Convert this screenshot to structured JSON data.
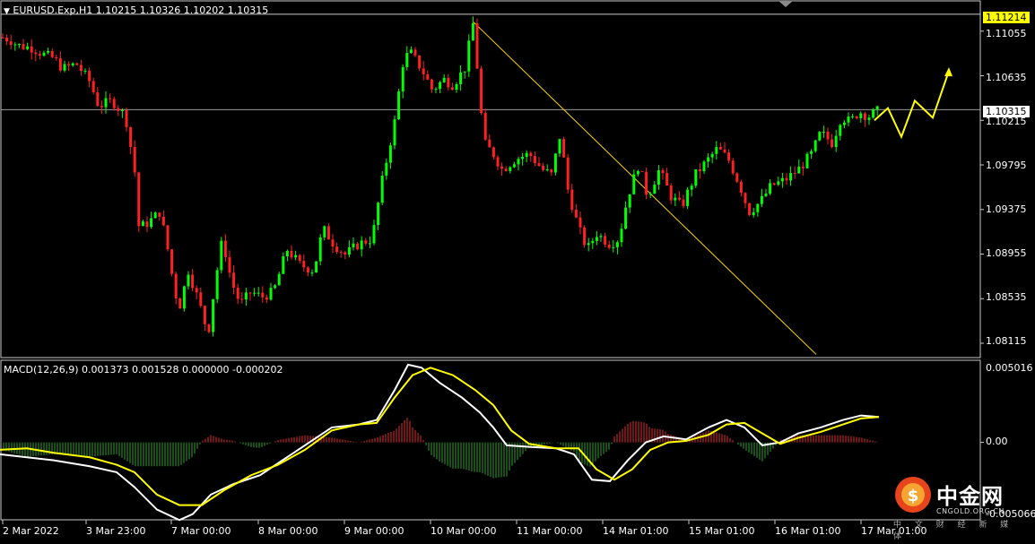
{
  "window": {
    "symbol_header": "EURUSD.Exp,H1  1.10215 1.10326 1.10202 1.10315",
    "macd_header": "MACD(12,26,9) 0.001373 0.001528 0.000000 -0.000202"
  },
  "price_axis": {
    "labels": [
      "1.11055",
      "1.10635",
      "1.10215",
      "1.09795",
      "1.09375",
      "1.08955",
      "1.08535",
      "1.08115"
    ],
    "high_badge": "1.11214",
    "current_badge": "1.10315"
  },
  "macd_axis": {
    "labels": [
      "0.005016",
      "0.00",
      "-0.005066"
    ]
  },
  "time_axis": {
    "labels": [
      "2 Mar 2022",
      "3 Mar 23:00",
      "7 Mar 00:00",
      "8 Mar 00:00",
      "9 Mar 00:00",
      "10 Mar 00:00",
      "11 Mar 00:00",
      "14 Mar 01:00",
      "15 Mar 01:00",
      "16 Mar 01:00",
      "17 Mar 01:00"
    ]
  },
  "watermark": {
    "brand": "中金网",
    "domain": "CNGOLD.ORG.CN",
    "tagline": "中 文 财 经 新 媒 体"
  },
  "colors": {
    "bull": "#00ff00",
    "bear": "#ff2020",
    "macd_line": "#ffffff",
    "signal_line": "#ffff00",
    "trendline": "#ffd800",
    "badge_high": "#ffff00",
    "badge_current": "#ffffff",
    "forecast_arrow": "#ffff00"
  },
  "chart_data": [
    {
      "type": "candlestick",
      "symbol": "EURUSD.Exp",
      "timeframe": "H1",
      "ylim": [
        1.0798,
        1.1134
      ],
      "ticks": [
        1.11055,
        1.10635,
        1.10215,
        1.09795,
        1.09375,
        1.08955,
        1.08535,
        1.08115
      ],
      "path": [
        [
          0,
          1.11
        ],
        [
          10,
          1.1098
        ],
        [
          20,
          1.1092
        ],
        [
          35,
          1.109
        ],
        [
          50,
          1.1083
        ],
        [
          60,
          1.108
        ],
        [
          70,
          1.107
        ],
        [
          85,
          1.1075
        ],
        [
          100,
          1.1058
        ],
        [
          110,
          1.1035
        ],
        [
          125,
          1.104
        ],
        [
          140,
          1.1025
        ],
        [
          150,
          1.0975
        ],
        [
          155,
          1.092
        ],
        [
          165,
          1.0925
        ],
        [
          178,
          1.0935
        ],
        [
          185,
          1.091
        ],
        [
          195,
          1.086
        ],
        [
          200,
          1.0845
        ],
        [
          210,
          1.088
        ],
        [
          222,
          1.085
        ],
        [
          232,
          1.082
        ],
        [
          240,
          1.087
        ],
        [
          248,
          1.091
        ],
        [
          258,
          1.087
        ],
        [
          268,
          1.0848
        ],
        [
          280,
          1.086
        ],
        [
          292,
          1.0855
        ],
        [
          305,
          1.086
        ],
        [
          320,
          1.09
        ],
        [
          335,
          1.0885
        ],
        [
          350,
          1.088
        ],
        [
          360,
          1.092
        ],
        [
          372,
          1.0905
        ],
        [
          385,
          1.0895
        ],
        [
          400,
          1.0905
        ],
        [
          415,
          1.091
        ],
        [
          425,
          1.096
        ],
        [
          440,
          1.102
        ],
        [
          450,
          1.108
        ],
        [
          458,
          1.1085
        ],
        [
          470,
          1.107
        ],
        [
          482,
          1.105
        ],
        [
          495,
          1.106
        ],
        [
          505,
          1.1055
        ],
        [
          518,
          1.107
        ],
        [
          528,
          1.1115
        ],
        [
          535,
          1.104
        ],
        [
          540,
          1.1
        ],
        [
          550,
          1.099
        ],
        [
          560,
          1.0975
        ],
        [
          575,
          1.0985
        ],
        [
          590,
          1.099
        ],
        [
          605,
          1.0975
        ],
        [
          615,
          1.097
        ],
        [
          625,
          1.101
        ],
        [
          632,
          1.096
        ],
        [
          645,
          1.092
        ],
        [
          655,
          1.09
        ],
        [
          665,
          1.0915
        ],
        [
          680,
          1.0905
        ],
        [
          690,
          1.091
        ],
        [
          700,
          1.095
        ],
        [
          712,
          1.098
        ],
        [
          722,
          1.095
        ],
        [
          735,
          1.0975
        ],
        [
          748,
          1.095
        ],
        [
          760,
          1.094
        ],
        [
          775,
          1.097
        ],
        [
          790,
          1.0985
        ],
        [
          800,
          1.0995
        ],
        [
          812,
          1.0985
        ],
        [
          825,
          1.096
        ],
        [
          835,
          1.0935
        ],
        [
          848,
          1.0945
        ],
        [
          860,
          1.096
        ],
        [
          875,
          1.0965
        ],
        [
          890,
          1.0975
        ],
        [
          905,
          1.099
        ],
        [
          915,
          1.101
        ],
        [
          928,
          1.1
        ],
        [
          938,
          1.1025
        ],
        [
          948,
          1.102
        ],
        [
          958,
          1.103
        ],
        [
          968,
          1.1025
        ],
        [
          978,
          1.103
        ]
      ],
      "current_price": 1.10315,
      "period_high": 1.11214,
      "trendline": {
        "from": [
          "10 Mar 00:00",
          1.1114
        ],
        "to": [
          "15 Mar 16:00",
          1.0801
        ]
      },
      "forecast_path": [
        1.10215,
        1.1033,
        1.1006,
        1.104,
        1.1024,
        1.1068
      ]
    },
    {
      "type": "line",
      "indicator": "MACD(12,26,9)",
      "ylim": [
        -0.005066,
        0.005016
      ],
      "series": [
        {
          "name": "MACD",
          "values": [
            [
              0,
              -0.0008
            ],
            [
              30,
              -0.001
            ],
            [
              60,
              -0.0012
            ],
            [
              100,
              -0.0016
            ],
            [
              130,
              -0.002
            ],
            [
              150,
              -0.003
            ],
            [
              175,
              -0.0045
            ],
            [
              200,
              -0.0052
            ],
            [
              215,
              -0.0048
            ],
            [
              235,
              -0.0035
            ],
            [
              260,
              -0.0028
            ],
            [
              290,
              -0.0022
            ],
            [
              320,
              -0.001
            ],
            [
              345,
              0.0
            ],
            [
              370,
              0.001
            ],
            [
              400,
              0.0012
            ],
            [
              420,
              0.0015
            ],
            [
              440,
              0.0035
            ],
            [
              455,
              0.0052
            ],
            [
              470,
              0.005
            ],
            [
              490,
              0.004
            ],
            [
              515,
              0.003
            ],
            [
              535,
              0.002
            ],
            [
              550,
              0.001
            ],
            [
              565,
              -0.0002
            ],
            [
              590,
              -0.0003
            ],
            [
              620,
              -0.0004
            ],
            [
              640,
              -0.0008
            ],
            [
              660,
              -0.0025
            ],
            [
              680,
              -0.0026
            ],
            [
              700,
              -0.0012
            ],
            [
              720,
              0.0
            ],
            [
              740,
              0.0004
            ],
            [
              765,
              0.0002
            ],
            [
              790,
              0.001
            ],
            [
              810,
              0.0015
            ],
            [
              830,
              0.001
            ],
            [
              850,
              -0.0002
            ],
            [
              870,
              0.0
            ],
            [
              890,
              0.0006
            ],
            [
              915,
              0.001
            ],
            [
              940,
              0.0015
            ],
            [
              960,
              0.0018
            ],
            [
              980,
              0.0017
            ]
          ]
        },
        {
          "name": "Signal",
          "values": [
            [
              0,
              -0.0005
            ],
            [
              30,
              -0.0004
            ],
            [
              60,
              -0.0007
            ],
            [
              100,
              -0.001
            ],
            [
              130,
              -0.0015
            ],
            [
              150,
              -0.002
            ],
            [
              175,
              -0.0035
            ],
            [
              200,
              -0.0042
            ],
            [
              225,
              -0.0042
            ],
            [
              250,
              -0.0032
            ],
            [
              280,
              -0.0022
            ],
            [
              310,
              -0.0015
            ],
            [
              340,
              -0.0005
            ],
            [
              370,
              0.0008
            ],
            [
              400,
              0.0012
            ],
            [
              420,
              0.0013
            ],
            [
              440,
              0.003
            ],
            [
              460,
              0.0045
            ],
            [
              480,
              0.005
            ],
            [
              505,
              0.0045
            ],
            [
              530,
              0.0035
            ],
            [
              550,
              0.0025
            ],
            [
              570,
              0.0008
            ],
            [
              590,
              -0.0001
            ],
            [
              620,
              -0.0004
            ],
            [
              645,
              -0.0004
            ],
            [
              665,
              -0.0018
            ],
            [
              685,
              -0.0025
            ],
            [
              705,
              -0.0018
            ],
            [
              725,
              -0.0005
            ],
            [
              745,
              0.0
            ],
            [
              765,
              0.0001
            ],
            [
              790,
              0.0005
            ],
            [
              810,
              0.0012
            ],
            [
              830,
              0.0013
            ],
            [
              850,
              0.0006
            ],
            [
              870,
              -0.0001
            ],
            [
              890,
              0.0003
            ],
            [
              915,
              0.0007
            ],
            [
              940,
              0.0012
            ],
            [
              960,
              0.0016
            ],
            [
              980,
              0.0017
            ]
          ]
        }
      ]
    }
  ]
}
